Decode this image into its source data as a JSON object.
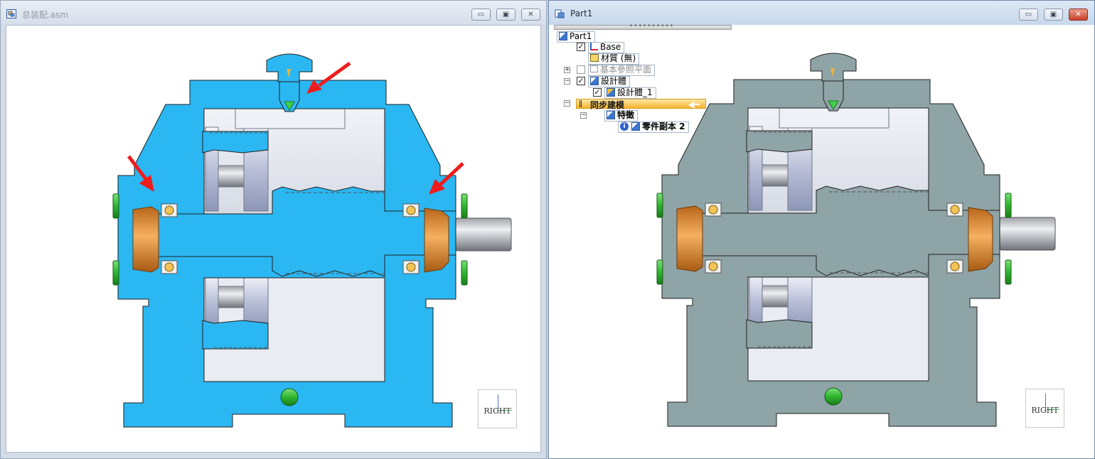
{
  "left_window": {
    "title": "总装配.asm",
    "buttons": {
      "minimize": "▭",
      "restore": "▣",
      "close": "✕"
    },
    "view_cube_label": "RIGHT",
    "colors": {
      "section_fill": "#2bb7f2",
      "bearing": "#e48f28",
      "bolt": "#32c832",
      "arrow": "#ee1c1c"
    }
  },
  "right_window": {
    "title": "Part1",
    "buttons": {
      "minimize": "▭",
      "restore": "▣",
      "close": "✕"
    },
    "view_cube_label": "RIGHT",
    "colors": {
      "section_fill": "#8fa4a6",
      "bolt": "#32c832"
    },
    "tree": {
      "root": "Part1",
      "base": "Base",
      "material": "材質 (無)",
      "ref_planes": "基本參照平面",
      "design_bodies": "設計體",
      "design_body_1": "設計體_1",
      "sync_modeling": "同步建模",
      "features": "特徵",
      "part_copy": "零件副本 2",
      "expand_plus": "+",
      "expand_minus": "−",
      "check": "✓",
      "info": "i"
    }
  }
}
